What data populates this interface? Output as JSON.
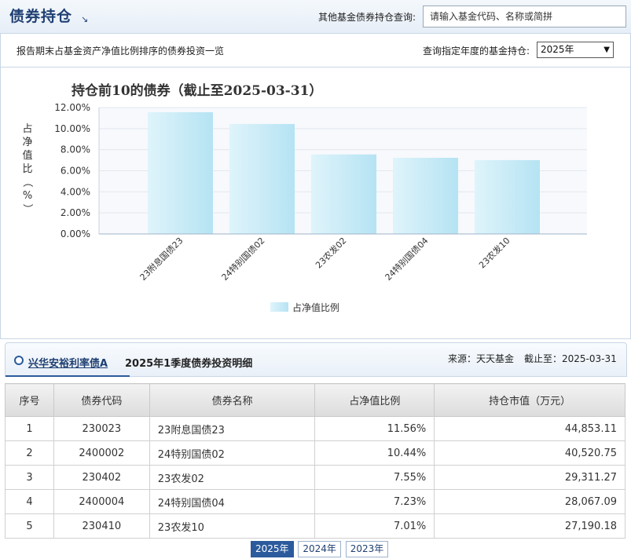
{
  "header": {
    "title": "债券持仓",
    "query_label": "其他基金债券持仓查询:",
    "query_placeholder": "请输入基金代码、名称或简拼"
  },
  "subbar": {
    "description": "报告期末占基金资产净值比例排序的债券投资一览",
    "year_label": "查询指定年度的基金持仓:",
    "year_selected": "2025年"
  },
  "chart_data": {
    "type": "bar",
    "title": "持仓前10的债券（截止至2025-03-31）",
    "ylabel": "占净值比（%）",
    "xlabel": "",
    "categories": [
      "23附息国债23",
      "24特别国债02",
      "23农发02",
      "24特别国债04",
      "23农发10"
    ],
    "series": [
      {
        "name": "占净值比例",
        "values": [
          11.56,
          10.44,
          7.55,
          7.23,
          7.01
        ]
      }
    ],
    "ylim": [
      0,
      12
    ],
    "yticks": [
      "0.00%",
      "2.00%",
      "4.00%",
      "6.00%",
      "8.00%",
      "10.00%",
      "12.00%"
    ],
    "legend": "bottom-center",
    "grid": true,
    "bar_color": "#c4eaf6"
  },
  "detail": {
    "fund_name": "兴华安裕利率债A",
    "title": "2025年1季度债券投资明细",
    "source": "来源：天天基金",
    "as_of": "截止至：2025-03-31"
  },
  "table": {
    "headers": [
      "序号",
      "债券代码",
      "债券名称",
      "占净值比例",
      "持仓市值（万元）"
    ],
    "rows": [
      [
        "1",
        "230023",
        "23附息国债23",
        "11.56%",
        "44,853.11"
      ],
      [
        "2",
        "2400002",
        "24特别国债02",
        "10.44%",
        "40,520.75"
      ],
      [
        "3",
        "230402",
        "23农发02",
        "7.55%",
        "29,311.27"
      ],
      [
        "4",
        "2400004",
        "24特别国债04",
        "7.23%",
        "28,067.09"
      ],
      [
        "5",
        "230410",
        "23农发10",
        "7.01%",
        "27,190.18"
      ]
    ]
  },
  "year_tabs": [
    {
      "label": "2025年",
      "active": true
    },
    {
      "label": "2024年",
      "active": false
    },
    {
      "label": "2023年",
      "active": false
    }
  ],
  "colors": {
    "accent": "#2b5b9c",
    "title": "#1f3f72"
  }
}
